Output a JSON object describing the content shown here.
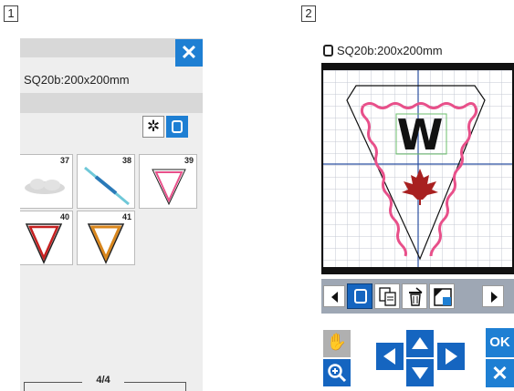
{
  "steps": {
    "left": "1",
    "right": "2"
  },
  "left_panel": {
    "close_label": "✕",
    "hoop_size": "SQ20b:200x200mm",
    "designs": [
      {
        "number": "37"
      },
      {
        "number": "38"
      },
      {
        "number": "39"
      },
      {
        "number": "40"
      },
      {
        "number": "41"
      }
    ],
    "page_indicator": "4/4"
  },
  "right_panel": {
    "hoop_size": "SQ20b:200x200mm",
    "design_letter": "W",
    "ok_label": "OK",
    "cancel_label": "✕"
  },
  "colors": {
    "accent_blue": "#1e7fd3",
    "pennant_pink": "#e8508a",
    "leaf_red": "#a82020",
    "grid_blue": "#2b4fa0"
  }
}
